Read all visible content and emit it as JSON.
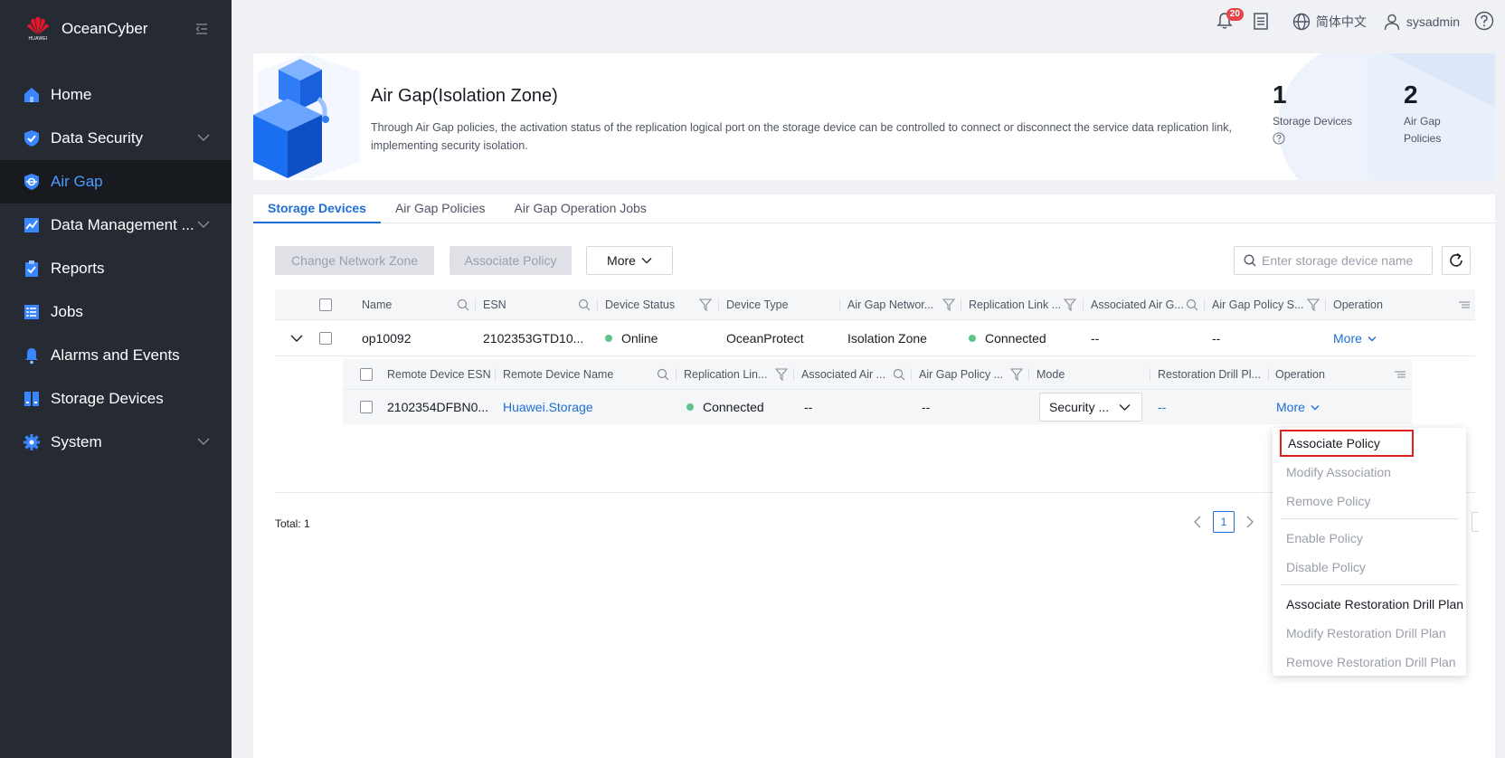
{
  "app": {
    "name": "OceanCyber",
    "logo_text": "HUAWEI"
  },
  "sidebar": {
    "items": [
      {
        "label": "Home",
        "icon": "home-icon",
        "has_children": false
      },
      {
        "label": "Data Security",
        "icon": "shield-icon",
        "has_children": true
      },
      {
        "label": "Air Gap",
        "icon": "air-gap-icon",
        "has_children": false,
        "active": true
      },
      {
        "label": "Data Management ...",
        "icon": "chart-icon",
        "has_children": true
      },
      {
        "label": "Reports",
        "icon": "clipboard-icon",
        "has_children": false
      },
      {
        "label": "Jobs",
        "icon": "list-icon",
        "has_children": false
      },
      {
        "label": "Alarms and Events",
        "icon": "bell-icon",
        "has_children": false
      },
      {
        "label": "Storage Devices",
        "icon": "storage-icon",
        "has_children": false
      },
      {
        "label": "System",
        "icon": "gear-icon",
        "has_children": true
      }
    ]
  },
  "header": {
    "notification_count": "20",
    "language": "简体中文",
    "user": "sysadmin"
  },
  "hero": {
    "title": "Air Gap(Isolation Zone)",
    "description": "Through Air Gap policies, the activation status of the replication logical port on the storage device can be controlled to connect or disconnect the service data replication link, implementing security isolation.",
    "stats": [
      {
        "value": "1",
        "label": "Storage Devices"
      },
      {
        "value": "2",
        "label_line1": "Air Gap",
        "label_line2": "Policies"
      }
    ]
  },
  "tabs": [
    "Storage Devices",
    "Air Gap Policies",
    "Air Gap Operation Jobs"
  ],
  "toolbar": {
    "change_zone": "Change Network Zone",
    "associate_policy": "Associate Policy",
    "more": "More",
    "search_placeholder": "Enter storage device name"
  },
  "table": {
    "columns": [
      "Name",
      "ESN",
      "Device Status",
      "Device Type",
      "Air Gap Networ...",
      "Replication Link ...",
      "Associated Air G...",
      "Air Gap Policy S...",
      "Operation"
    ],
    "rows": [
      {
        "name": "op10092",
        "esn": "2102353GTD10...",
        "status": "Online",
        "type": "OceanProtect",
        "zone": "Isolation Zone",
        "link": "Connected",
        "policy": "--",
        "policy_status": "--",
        "operation": "More"
      }
    ]
  },
  "subtable": {
    "columns": [
      "Remote Device ESN",
      "Remote Device Name",
      "Replication Lin...",
      "Associated Air ...",
      "Air Gap Policy ...",
      "Mode",
      "Restoration Drill Pl...",
      "Operation"
    ],
    "rows": [
      {
        "esn": "2102354DFBN0...",
        "name": "Huawei.Storage",
        "link": "Connected",
        "policy": "--",
        "policy_status": "--",
        "mode": "Security ...",
        "drill": "--",
        "operation": "More"
      }
    ]
  },
  "pagination": {
    "total": "Total: 1",
    "page": "1"
  },
  "menu": {
    "items": [
      {
        "label": "Associate Policy",
        "enabled": true,
        "highlighted": true
      },
      {
        "label": "Modify Association",
        "enabled": false
      },
      {
        "label": "Remove Policy",
        "enabled": false
      },
      {
        "label": "Enable Policy",
        "enabled": false
      },
      {
        "label": "Disable Policy",
        "enabled": false
      },
      {
        "label": "Associate Restoration Drill Plan",
        "enabled": true
      },
      {
        "label": "Modify Restoration Drill Plan",
        "enabled": false
      },
      {
        "label": "Remove Restoration Drill Plan",
        "enabled": false
      }
    ]
  },
  "colors": {
    "accent": "#1f6ed4",
    "sidebar_bg": "#252a33",
    "success": "#5ec48a",
    "highlight_border": "#e02020"
  }
}
